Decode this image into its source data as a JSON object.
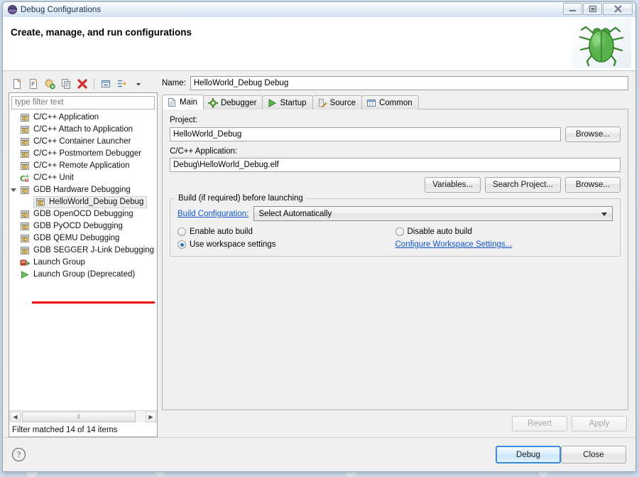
{
  "window": {
    "title": "Debug Configurations",
    "title_icon": "eclipse-ellipse-icon",
    "minimize_label": "Minimize",
    "maximize_label": "Restore",
    "close_label": "Close"
  },
  "banner": {
    "heading": "Create, manage, and run configurations",
    "icon": "green-bug-icon"
  },
  "toolbar": {
    "buttons": [
      {
        "name": "new-configuration",
        "icon": "new-document-icon"
      },
      {
        "name": "new-prototype",
        "icon": "new-prototype-icon"
      },
      {
        "name": "export-configuration",
        "icon": "export-icon"
      },
      {
        "name": "duplicate-configuration",
        "icon": "duplicate-icon"
      },
      {
        "name": "delete-configuration",
        "icon": "delete-red-x-icon"
      },
      {
        "name": "collapse-all",
        "icon": "collapse-all-icon"
      },
      {
        "name": "filter-configurations",
        "icon": "filter-icon"
      },
      {
        "name": "view-menu",
        "icon": "chevron-down-icon"
      }
    ]
  },
  "filter": {
    "placeholder": "type filter text",
    "value": "",
    "status": "Filter matched 14 of 14 items"
  },
  "tree": {
    "items": [
      {
        "label": "C/C++ Application",
        "icon": "c-file-icon",
        "level": 0,
        "expander": "none",
        "selected": false
      },
      {
        "label": "C/C++ Attach to Application",
        "icon": "c-file-icon",
        "level": 0,
        "expander": "none",
        "selected": false
      },
      {
        "label": "C/C++ Container Launcher",
        "icon": "c-file-icon",
        "level": 0,
        "expander": "none",
        "selected": false
      },
      {
        "label": "C/C++ Postmortem Debugger",
        "icon": "c-file-icon",
        "level": 0,
        "expander": "none",
        "selected": false
      },
      {
        "label": "C/C++ Remote Application",
        "icon": "c-file-icon",
        "level": 0,
        "expander": "none",
        "selected": false
      },
      {
        "label": "C/C++ Unit",
        "icon": "cpp-unit-icon",
        "level": 0,
        "expander": "none",
        "selected": false
      },
      {
        "label": "GDB Hardware Debugging",
        "icon": "c-file-icon",
        "level": 0,
        "expander": "open",
        "selected": false,
        "underlined": true
      },
      {
        "label": "HelloWorld_Debug Debug",
        "icon": "c-file-icon",
        "level": 1,
        "expander": "none",
        "selected": true
      },
      {
        "label": "GDB OpenOCD Debugging",
        "icon": "c-file-icon",
        "level": 0,
        "expander": "none",
        "selected": false
      },
      {
        "label": "GDB PyOCD Debugging",
        "icon": "c-file-icon",
        "level": 0,
        "expander": "none",
        "selected": false
      },
      {
        "label": "GDB QEMU Debugging",
        "icon": "c-file-icon",
        "level": 0,
        "expander": "none",
        "selected": false
      },
      {
        "label": "GDB SEGGER J-Link Debugging",
        "icon": "c-file-icon",
        "level": 0,
        "expander": "none",
        "selected": false
      },
      {
        "label": "Launch Group",
        "icon": "launch-group-icon",
        "level": 0,
        "expander": "none",
        "selected": false
      },
      {
        "label": "Launch Group (Deprecated)",
        "icon": "launch-group-deprecated-icon",
        "level": 0,
        "expander": "none",
        "selected": false
      }
    ],
    "scrollbar": {
      "left_arrow": "◀",
      "right_arrow": "▶",
      "grip": "‖"
    }
  },
  "name_field": {
    "label": "Name:",
    "value": "HelloWorld_Debug Debug",
    "placeholder": ""
  },
  "tabs": [
    {
      "label": "Main",
      "icon": "document-icon",
      "active": true
    },
    {
      "label": "Debugger",
      "icon": "debugger-gear-icon",
      "active": false
    },
    {
      "label": "Startup",
      "icon": "startup-play-icon",
      "active": false
    },
    {
      "label": "Source",
      "icon": "source-pencil-icon",
      "active": false
    },
    {
      "label": "Common",
      "icon": "common-table-icon",
      "active": false
    }
  ],
  "main_tab": {
    "project": {
      "label": "Project:",
      "value": "HelloWorld_Debug",
      "browse_label": "Browse..."
    },
    "application": {
      "label": "C/C++ Application:",
      "value": "Debug\\HelloWorld_Debug.elf",
      "variables_label": "Variables...",
      "search_project_label": "Search Project...",
      "browse_label": "Browse..."
    },
    "build_group": {
      "title": "Build (if required) before launching",
      "build_configuration_link": "Build Configuration:",
      "build_configuration_value": "Select Automatically",
      "options": [
        {
          "label": "Enable auto build",
          "checked": false
        },
        {
          "label": "Disable auto build",
          "checked": false
        },
        {
          "label": "Use workspace settings",
          "checked": true
        }
      ],
      "configure_link": "Configure Workspace Settings..."
    }
  },
  "panel_buttons": {
    "revert": {
      "label": "Revert",
      "enabled": false
    },
    "apply": {
      "label": "Apply",
      "enabled": false
    }
  },
  "footer": {
    "help_icon": "help-question-icon",
    "help_glyph": "?",
    "debug": {
      "label": "Debug",
      "default": true
    },
    "close": {
      "label": "Close",
      "default": false
    }
  },
  "colors": {
    "accent_link": "#1155cc",
    "underline_red": "#ee1111",
    "radio_blue": "#2a78c8",
    "default_button_border": "#3c8ddc",
    "panel_bg": "#f0f0f0"
  }
}
